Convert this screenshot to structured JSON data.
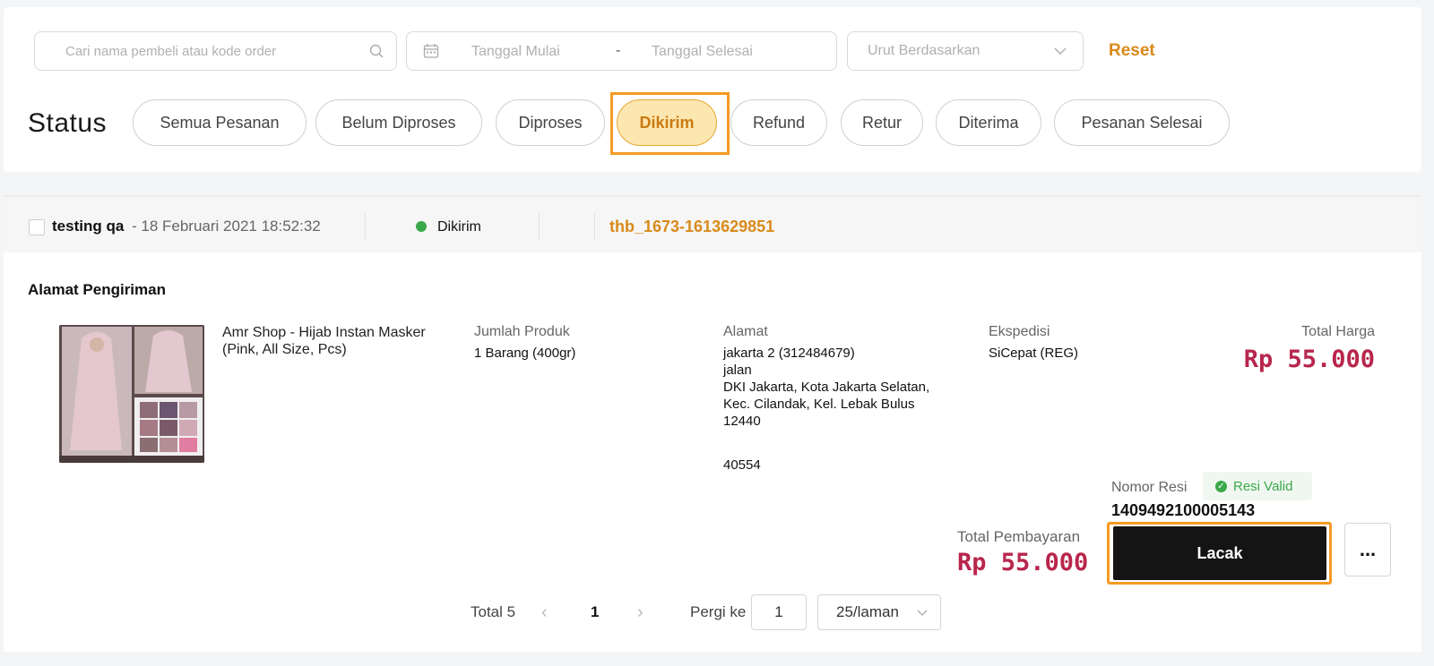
{
  "filters": {
    "search_placeholder": "Cari nama pembeli atau kode order",
    "date_start_placeholder": "Tanggal Mulai",
    "date_separator": "-",
    "date_end_placeholder": "Tanggal Selesai",
    "sort_placeholder": "Urut Berdasarkan",
    "reset_label": "Reset"
  },
  "status": {
    "label": "Status",
    "tabs": [
      {
        "label": "Semua Pesanan"
      },
      {
        "label": "Belum Diproses"
      },
      {
        "label": "Diproses"
      },
      {
        "label": "Dikirim",
        "active": true
      },
      {
        "label": "Refund"
      },
      {
        "label": "Retur"
      },
      {
        "label": "Diterima"
      },
      {
        "label": "Pesanan Selesai"
      }
    ]
  },
  "order": {
    "buyer": "testing qa",
    "date": "- 18 Februari 2021 18:52:32",
    "status": "Dikirim",
    "code": "thb_1673-1613629851",
    "address_title": "Alamat Pengiriman",
    "product_name": "Amr Shop - Hijab Instan Masker (Pink, All Size, Pcs)",
    "qty_label": "Jumlah Produk",
    "qty_value": "1 Barang (400gr)",
    "address_label": "Alamat",
    "address_lines": [
      "jakarta 2 (312484679)",
      "jalan",
      "DKI Jakarta, Kota Jakarta Selatan,",
      "Kec. Cilandak, Kel. Lebak Bulus",
      "12440"
    ],
    "address_code": "40554",
    "courier_label": "Ekspedisi",
    "courier_value": "SiCepat (REG)",
    "price_label": "Total Harga",
    "price_value": "Rp 55.000",
    "resi_label": "Nomor Resi",
    "resi_badge": "Resi Valid",
    "resi_number": "1409492100005143",
    "total_label": "Total Pembayaran",
    "total_value": "Rp 55.000",
    "track_label": "Lacak",
    "more_label": "..."
  },
  "pagination": {
    "total": "Total 5",
    "current_page": "1",
    "goto_label": "Pergi ke",
    "goto_value": "1",
    "page_size": "25/laman"
  },
  "colors": {
    "accent": "#d98a1a",
    "price": "#b8264c",
    "status_green": "#3aa84a",
    "highlight_outline": "#f59a23"
  }
}
